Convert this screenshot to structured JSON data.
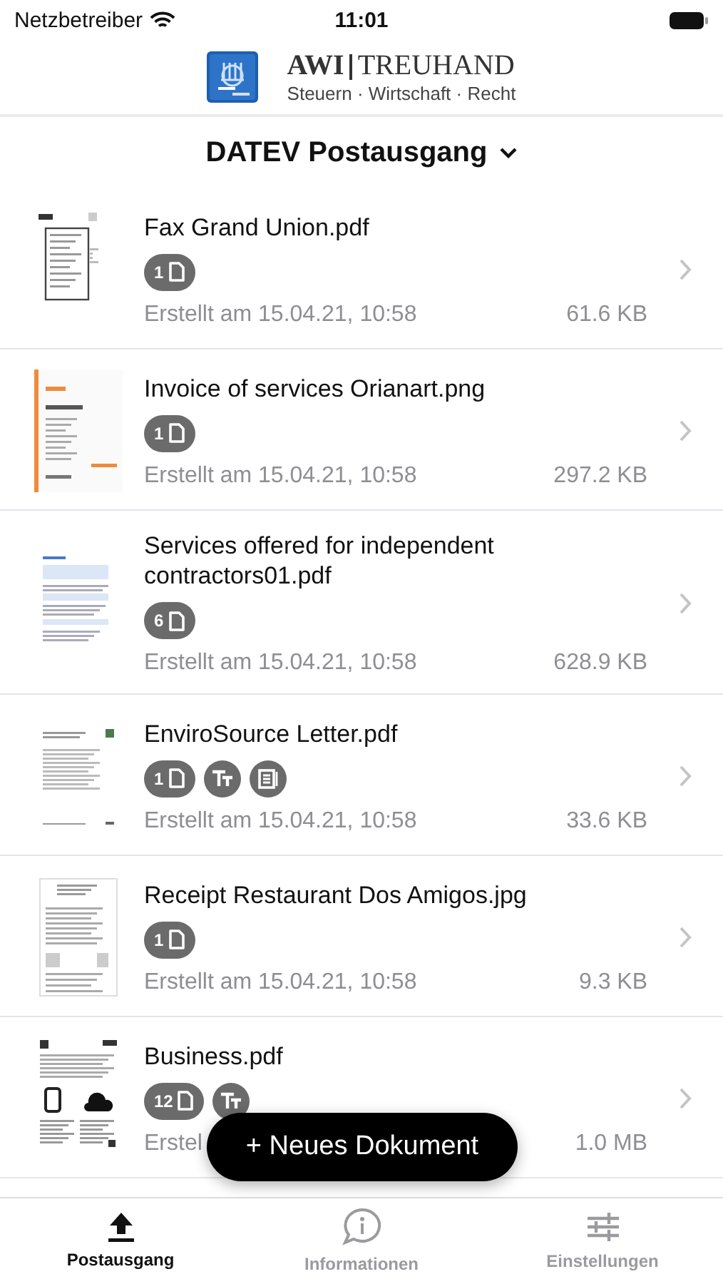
{
  "status_bar": {
    "carrier": "Netzbetreiber",
    "time": "11:01"
  },
  "header": {
    "brand": "AWI",
    "brand_suffix": "TREUHAND",
    "tagline": "Steuern · Wirtschaft · Recht"
  },
  "title": "DATEV Postausgang",
  "documents": [
    {
      "name": "Fax Grand Union.pdf",
      "badges": [
        {
          "kind": "pages",
          "count": "1"
        }
      ],
      "created": "Erstellt am 15.04.21, 10:58",
      "size": "61.6 KB"
    },
    {
      "name": "Invoice of services Orianart.png",
      "badges": [
        {
          "kind": "pages",
          "count": "1"
        }
      ],
      "created": "Erstellt am 15.04.21, 10:58",
      "size": "297.2 KB"
    },
    {
      "name": "Services offered for independent contractors01.pdf",
      "badges": [
        {
          "kind": "pages",
          "count": "6"
        }
      ],
      "created": "Erstellt am 15.04.21, 10:58",
      "size": "628.9 KB"
    },
    {
      "name": "EnviroSource Letter.pdf",
      "badges": [
        {
          "kind": "pages",
          "count": "1"
        },
        {
          "kind": "text"
        },
        {
          "kind": "scan"
        }
      ],
      "created": "Erstellt am 15.04.21, 10:58",
      "size": "33.6 KB"
    },
    {
      "name": "Receipt Restaurant Dos Amigos.jpg",
      "badges": [
        {
          "kind": "pages",
          "count": "1"
        }
      ],
      "created": "Erstellt am 15.04.21, 10:58",
      "size": "9.3 KB"
    },
    {
      "name": "Business.pdf",
      "badges": [
        {
          "kind": "pages",
          "count": "12"
        },
        {
          "kind": "text"
        }
      ],
      "created": "Erstel",
      "size": "1.0 MB"
    }
  ],
  "new_button": "+ Neues Dokument",
  "tabs": [
    {
      "label": "Postausgang",
      "selected": true
    },
    {
      "label": "Informationen",
      "selected": false
    },
    {
      "label": "Einstellungen",
      "selected": false
    }
  ]
}
